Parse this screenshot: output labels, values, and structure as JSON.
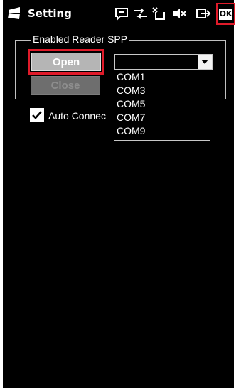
{
  "titlebar": {
    "title": "Setting",
    "start_icon": "windows-flag-icon",
    "status_icons": [
      "messaging-icon",
      "connectivity-icon",
      "no-sim-icon",
      "volume-muted-icon",
      "battery-icon"
    ],
    "ok_label": "OK"
  },
  "groupbox": {
    "label": "Enabled Reader SPP",
    "open_label": "Open",
    "close_label": "Close",
    "port_combo": {
      "value": "",
      "options": [
        "COM1",
        "COM3",
        "COM5",
        "COM7",
        "COM9"
      ]
    }
  },
  "auto_connect": {
    "label": "Auto Connec",
    "checked": true
  },
  "colors": {
    "background": "#000000",
    "highlight": "#e01b2a",
    "button_enabled": "#b5b5b5",
    "button_disabled": "#6e6e6e"
  }
}
